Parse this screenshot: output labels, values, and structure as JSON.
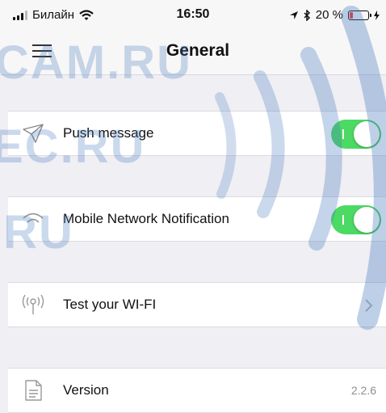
{
  "status_bar": {
    "carrier": "Билайн",
    "time": "16:50",
    "battery_percent": "20 %",
    "battery_level": 0.2,
    "icons": [
      "signal-icon",
      "wifi-icon",
      "location-arrow-icon",
      "bluetooth-icon",
      "battery-icon",
      "charging-icon"
    ]
  },
  "nav": {
    "title": "General",
    "menu_icon": "hamburger-menu-icon"
  },
  "rows": [
    {
      "label": "Push message",
      "icon": "paper-plane-icon",
      "control": "toggle",
      "on": true
    },
    {
      "label": "Mobile Network Notification",
      "icon": "network-signal-icon",
      "control": "toggle",
      "on": true
    },
    {
      "label": "Test your WI-FI",
      "icon": "wifi-antenna-icon",
      "control": "chevron"
    },
    {
      "label": "Version",
      "icon": "document-icon",
      "value": "2.2.6"
    }
  ],
  "watermark": {
    "line1": "CAM.RU",
    "line2": "EC.RU",
    "line3": ".RU"
  },
  "colors": {
    "toggle_on": "#4cd964",
    "background": "#efeff4",
    "battery_low": "#ff3b30"
  }
}
